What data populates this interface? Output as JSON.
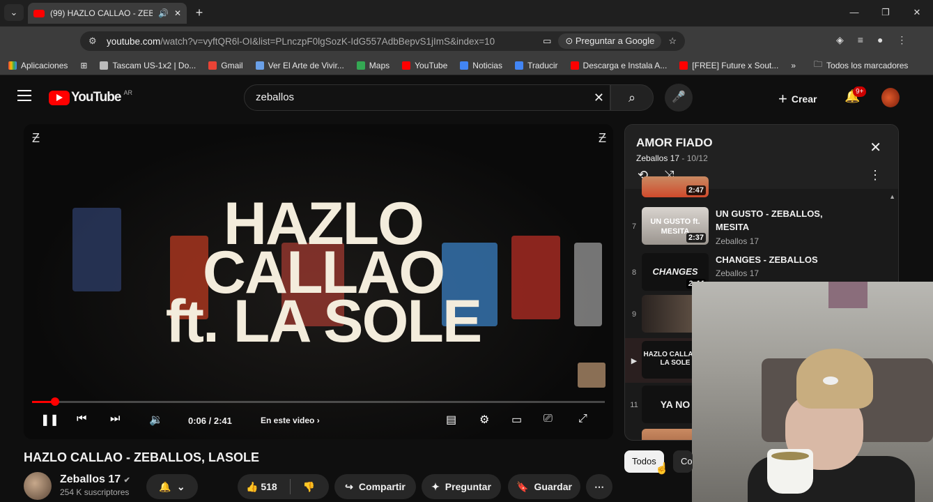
{
  "browser": {
    "tab_title": "(99) HAZLO CALLAO - ZEBA",
    "url_domain": "youtube.com",
    "url_path": "/watch?v=vyftQR6l-OI&list=PLnczpF0lgSozK-IdG557AdbBepvS1jImS&index=10",
    "google_lens_label": "Preguntar a Google",
    "bookmarks": [
      "Aplicaciones",
      "Tascam US-1x2 | Do...",
      "Gmail",
      "Ver El Arte de Vivir...",
      "Maps",
      "YouTube",
      "Noticias",
      "Traducir",
      "Descarga e Instala A...",
      "[FREE] Future x Sout..."
    ],
    "all_bookmarks_label": "Todos los marcadores"
  },
  "youtube": {
    "logo_text": "YouTube",
    "country": "AR",
    "search_value": "zeballos",
    "create_label": "Crear",
    "notif_count": "9+"
  },
  "player": {
    "video_title_lines": [
      "HAZLO",
      "CALLAO",
      "ft. LA SOLE"
    ],
    "time": "0:06 / 2:41",
    "chapter": "En este video",
    "progress_fraction": 0.04
  },
  "video": {
    "title": "HAZLO CALLAO - ZEBALLOS, LASOLE",
    "channel": "Zeballos 17",
    "subscribers": "254 K suscriptores",
    "likes": "518",
    "share": "Compartir",
    "ask": "Preguntar",
    "save": "Guardar"
  },
  "playlist": {
    "title": "AMOR FIADO",
    "owner": "Zeballos 17",
    "position": "- 10/12",
    "items": [
      {
        "index": "",
        "title": "",
        "channel": "",
        "duration": "2:47",
        "thumb": ""
      },
      {
        "index": "7",
        "title": "UN GUSTO - ZEBALLOS, MESITA",
        "channel": "Zeballos 17",
        "duration": "2:37",
        "thumb": "UN GUSTO ft. MESITA"
      },
      {
        "index": "8",
        "title": "CHANGES - ZEBALLOS",
        "channel": "Zeballos 17",
        "duration": "2:44",
        "thumb": "CHANGES"
      },
      {
        "index": "9",
        "title": "",
        "channel": "",
        "duration": "",
        "thumb": ""
      },
      {
        "index": "▶",
        "title": "",
        "channel": "",
        "duration": "",
        "thumb": "HAZLO CALLAO ft. LA SOLE"
      },
      {
        "index": "11",
        "title": "",
        "channel": "",
        "duration": "",
        "thumb": "YA NO"
      }
    ]
  },
  "chips": [
    "Todos",
    "Co"
  ]
}
